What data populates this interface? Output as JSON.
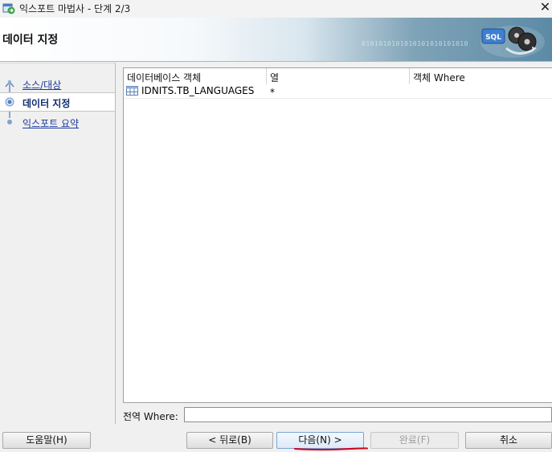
{
  "window": {
    "title": "익스포트 마법사 - 단계 2/3",
    "close_glyph": "✕"
  },
  "banner": {
    "title": "데이터 지정",
    "binary_text": "0101010101010101010101010",
    "art_label": "SQL"
  },
  "steps": [
    {
      "label": "소스/대상",
      "state": "link"
    },
    {
      "label": "데이터 지정",
      "state": "active"
    },
    {
      "label": "익스포트 요약",
      "state": "link"
    }
  ],
  "table": {
    "columns": [
      "데이터베이스 객체",
      "열",
      "객체 Where"
    ],
    "rows": [
      {
        "object": "IDNITS.TB_LANGUAGES",
        "columns_value": "*",
        "where": ""
      }
    ]
  },
  "global_where": {
    "label": "전역 Where:",
    "value": ""
  },
  "buttons": {
    "help": "도움말(H)",
    "back": "< 뒤로(B)",
    "next": "다음(N) >",
    "finish": "완료(F)",
    "cancel": "취소"
  },
  "icons": {
    "app": "export-wizard-icon",
    "close": "close-icon",
    "table": "table-icon",
    "banner": "database-export-icon"
  },
  "colors": {
    "link": "#1a3a9c",
    "active_step": "#102c6e",
    "annotation": "#d0021b"
  }
}
